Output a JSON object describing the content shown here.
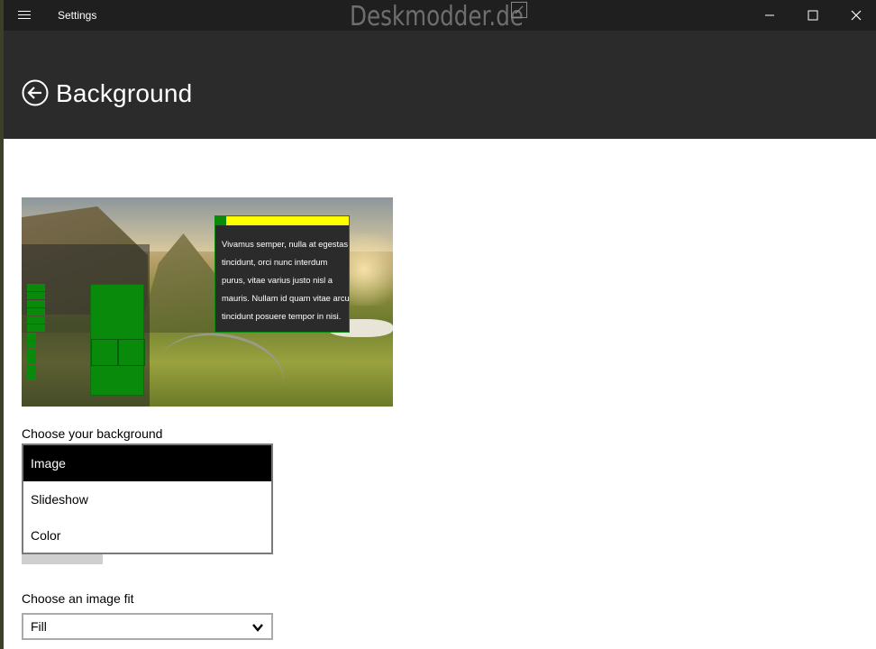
{
  "window": {
    "title": "Settings",
    "watermark": "Deskmodder.de"
  },
  "header": {
    "title": "Background"
  },
  "preview": {
    "window_text": "Vivamus semper, nulla at egestas\ntincidunt, orci nunc interdum\npurus, vitae varius justo nisl a\nmauris. Nullam id quam vitae arcu\ntincidunt posuere tempor in nisi.",
    "accent_color": "#008000",
    "titlebar_color": "#ffff00"
  },
  "background_section": {
    "label": "Choose your background",
    "options": [
      "Image",
      "Slideshow",
      "Color"
    ],
    "selected": "Image"
  },
  "fit_section": {
    "label": "Choose an image fit",
    "value": "Fill"
  },
  "icons": {
    "menu": "hamburger-icon",
    "minimize": "minimize-icon",
    "maximize": "maximize-icon",
    "close": "close-icon",
    "back": "back-arrow-icon",
    "dropdown": "chevron-down-icon"
  }
}
